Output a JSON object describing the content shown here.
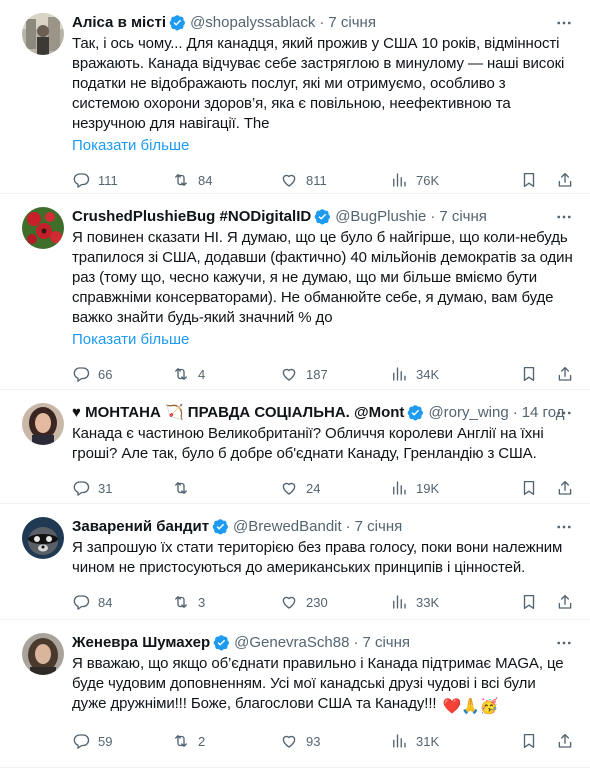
{
  "tweets": [
    {
      "name": "Аліса в місті",
      "handle": "@shopalyssablack",
      "time": "7 січня",
      "text": "Так, і ось чому... Для канадця, який прожив у США 10 років, відмінності вражають. Канада відчуває себе застряглою в минулому — наші високі податки не відображають послуг, які ми отримуємо, особливо з системою охорони здоров’я, яка є повільною, неефективною та незручною для навігації. The",
      "show_more": "Показати більше",
      "replies": "111",
      "reposts": "84",
      "likes": "811",
      "views": "76K"
    },
    {
      "name": "CrushedPlushieBug #NODigitalID",
      "handle": "@BugPlushie",
      "time": "7 січня",
      "text": "Я повинен сказати НІ. Я думаю, що це було б найгірше, що коли-небудь трапилося зі США, додавши (фактично) 40 мільйонів демократів за один раз (тому що, чесно кажучи, я не думаю, що ми більше вміємо бути справжніми консерваторами). Не обманюйте себе, я думаю, вам буде важко знайти будь-який значний % до",
      "show_more": "Показати більше",
      "replies": "66",
      "reposts": "4",
      "likes": "187",
      "views": "34K"
    },
    {
      "name": "♥ МОНТАНА 🏹 ПРАВДА СОЦІАЛЬНА. @Mont",
      "handle": "@rory_wing",
      "time": "14 год",
      "text": "Канада є частиною Великобританії? Обличчя королеви Англії на їхні гроші? Але так, було б добре об'єднати Канаду, Гренландію з США.",
      "replies": "31",
      "reposts": "",
      "likes": "24",
      "views": "19K"
    },
    {
      "name": "Заварений бандит",
      "handle": "@BrewedBandit",
      "time": "7 січня",
      "text": "Я запрошую їх стати територією без права голосу, поки вони належним чином не пристосуються до американських принципів і цінностей.",
      "replies": "84",
      "reposts": "3",
      "likes": "230",
      "views": "33K"
    },
    {
      "name": "Женевра Шумахер",
      "handle": "@GenevraSch88",
      "time": "7 січня",
      "text": "Я вважаю, що якщо об’єднати правильно і Канада підтримає MAGA, це буде чудовим доповненням. Усі мої канадські друзі чудові і всі були дуже дружніми!!! Боже, благослови США та Канаду!!!",
      "emoji": "❤️🙏🥳",
      "replies": "59",
      "reposts": "2",
      "likes": "93",
      "views": "31K"
    }
  ],
  "colors": {
    "accent": "#1d9bf0",
    "muted": "#536471",
    "verified": "#1d9bf0"
  },
  "icons": [
    "reply-icon",
    "repost-icon",
    "like-icon",
    "views-icon",
    "bookmark-icon",
    "share-icon",
    "more-icon",
    "verified-icon"
  ]
}
